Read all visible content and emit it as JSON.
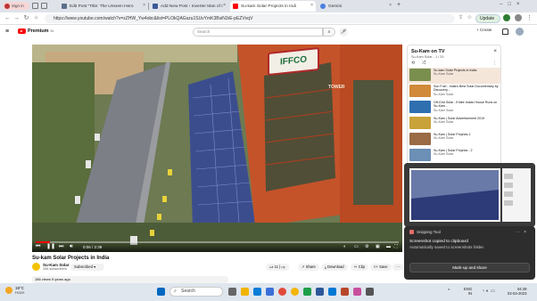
{
  "browser": {
    "profile_label": "Sign in",
    "tabs": [
      {
        "title": "Edit Post \"Title: The Unseen Hero",
        "active": false,
        "color": "#5b6f8a"
      },
      {
        "title": "Add New Post ‹ Inverter Man of I",
        "active": false,
        "color": "#3c5a99"
      },
      {
        "title": "Su-kam Solar Projects in Indi",
        "active": true,
        "color": "#ff0000"
      },
      {
        "title": "Gemini",
        "active": false,
        "color": "#4a7fe0"
      }
    ],
    "new_tab": "+",
    "url": "https://www.youtube.com/watch?v=zZHW_Yw4obc&list=PLOkQAGszu1SUvYmK3BsiN3rE-pEZVvqV",
    "update_label": "Update"
  },
  "youtube": {
    "logo_text": "Premium",
    "logo_suffix": "IN",
    "search_placeholder": "Search",
    "create_label": "+ Create"
  },
  "video": {
    "time": "0:06 / 2:39",
    "progress": 0.04,
    "billboard": "IFFCO",
    "sign": "TOWER",
    "title": "Su-kam Solar Projects in India",
    "channel": "Su-Kam Solar",
    "subscribers": "338 subscribers",
    "subscribe_label": "Subscribed",
    "likes": "11",
    "share_label": "Share",
    "download_label": "Download",
    "clip_label": "Clip",
    "save_label": "Save",
    "more_label": "···",
    "views": "186 views  9 years ago"
  },
  "playlist": {
    "title": "Su-Kam on TV",
    "subtitle": "Su-Kam Solar - 1 / 25",
    "items": [
      {
        "title": "Su-kam Solar Projects in India",
        "channel": "Su-Kam Solar",
        "active": true,
        "color": "#7a8f4e"
      },
      {
        "title": "Sun Fuel - India's Best Solar Documentary by Discovery...",
        "channel": "Su-Kam Solar",
        "active": false,
        "color": "#d08a3a"
      },
      {
        "title": "Off-Grid Solar - Entire Indian House Runs on Su-Kam...",
        "channel": "Su-Kam Solar",
        "active": false,
        "color": "#2f6fb0"
      },
      {
        "title": "Su-Kam | Solar Advertisement 2019",
        "channel": "Su-Kam Solar",
        "active": false,
        "color": "#c9a23a"
      },
      {
        "title": "Su-Kam | Solar Projects-1",
        "channel": "Su-Kam Solar",
        "active": false,
        "color": "#9a6b44"
      },
      {
        "title": "Su-Kam | Solar Projects - 2",
        "channel": "Su-Kam Solar",
        "active": false,
        "color": "#6b8fb5"
      }
    ]
  },
  "snipping": {
    "app": "Snipping Tool",
    "heading": "Screenshot copied to clipboard",
    "body": "Automatically saved to screenshots folder.",
    "button": "Mark-up and share"
  },
  "taskbar": {
    "temperature": "19°C",
    "weather": "Haze",
    "search_label": "Search",
    "language": "ENG",
    "region": "IN",
    "time": "04:49",
    "date": "02-04-2023"
  }
}
